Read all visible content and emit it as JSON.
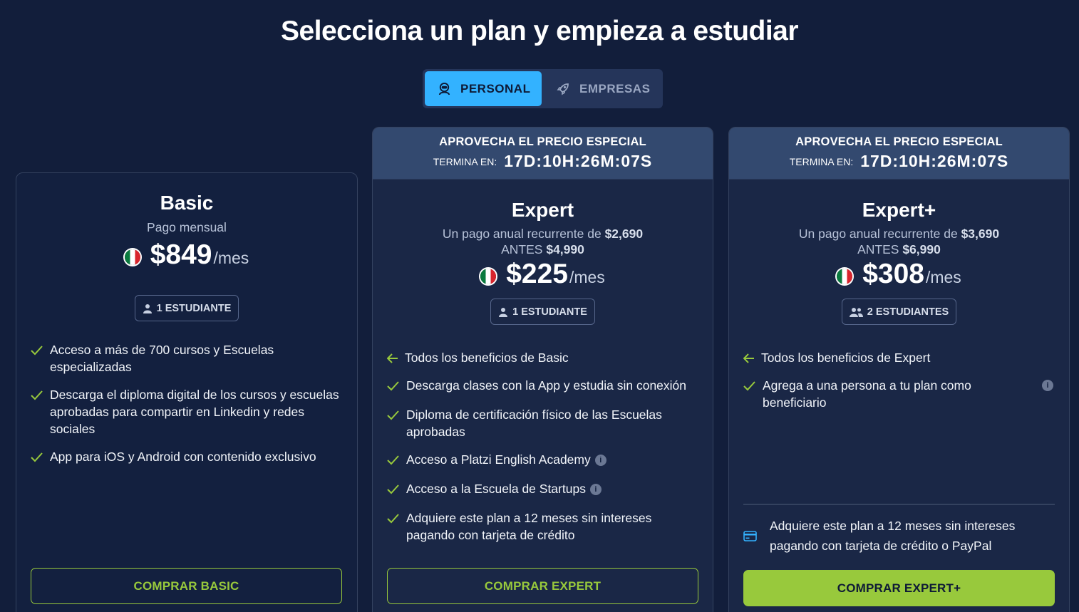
{
  "title": "Selecciona un plan y empieza a estudiar",
  "toggle": {
    "personal": "PERSONAL",
    "empresas": "EMPRESAS"
  },
  "promo": {
    "headline": "APROVECHA EL PRECIO ESPECIAL",
    "ends_label": "TERMINA EN:",
    "countdown": "17D:10H:26M:07S"
  },
  "colors": {
    "background": "#121e3b",
    "accent_blue": "#33b2ff",
    "accent_green": "#98c93c"
  },
  "plans": [
    {
      "name": "Basic",
      "billing": "Pago mensual",
      "price": "$849",
      "per": "/mes",
      "students": "1 ESTUDIANTE",
      "features": [
        "Acceso a más de 700 cursos y Escuelas especializadas",
        "Descarga el diploma digital de los cursos y escuelas aprobadas para compartir en Linkedin y redes sociales",
        "App para iOS y Android con contenido exclusivo"
      ],
      "cta": "COMPRAR BASIC"
    },
    {
      "name": "Expert",
      "billing_prefix": "Un pago anual recurrente de",
      "billing_amount": "$2,690",
      "before_label": "ANTES",
      "before_price": "$4,990",
      "price": "$225",
      "per": "/mes",
      "students": "1 ESTUDIANTE",
      "inherit": "Todos los beneficios de Basic",
      "features": [
        "Descarga clases con la App y estudia sin conexión",
        "Diploma de certificación físico de las Escuelas aprobadas",
        "Acceso a Platzi English Academy",
        "Acceso a la Escuela de Startups",
        "Adquiere este plan a 12 meses sin intereses pagando con tarjeta de crédito"
      ],
      "cta": "COMPRAR EXPERT"
    },
    {
      "name": "Expert+",
      "billing_prefix": "Un pago anual recurrente de",
      "billing_amount": "$3,690",
      "before_label": "ANTES",
      "before_price": "$6,990",
      "price": "$308",
      "per": "/mes",
      "students": "2 ESTUDIANTES",
      "inherit": "Todos los beneficios de Expert",
      "features": [
        "Agrega a una persona a tu plan como beneficiario"
      ],
      "installments": "Adquiere este plan a 12 meses sin intereses pagando con tarjeta de crédito o PayPal",
      "cta": "COMPRAR EXPERT+"
    }
  ],
  "icons": [
    "user-astronaut-icon",
    "rocket-icon",
    "mexico-flag-icon",
    "user-icon",
    "users-icon",
    "check-icon",
    "arrow-left-icon",
    "info-icon",
    "credit-card-icon"
  ]
}
